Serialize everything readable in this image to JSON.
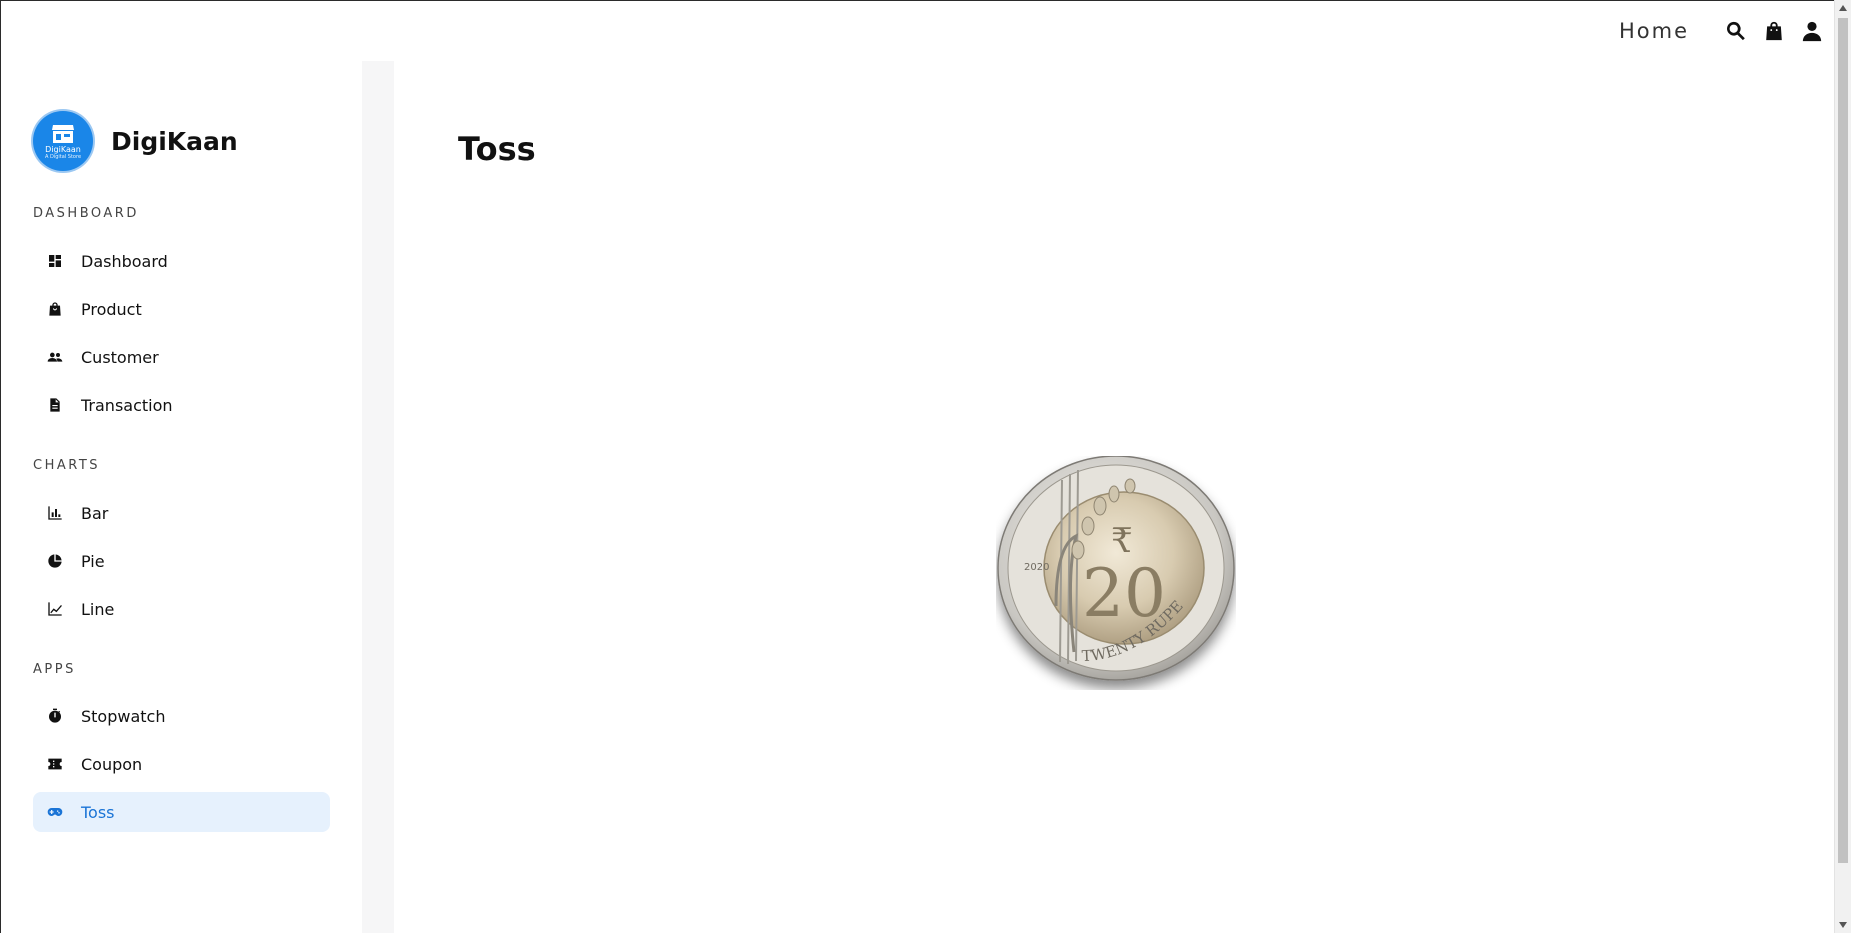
{
  "header": {
    "home_label": "Home",
    "icons": [
      "search-icon",
      "shopping-bag-icon",
      "user-icon"
    ]
  },
  "brand": {
    "name": "DigiKaan",
    "logo_line1": "DigiKaan",
    "logo_line2": "A Digital Store",
    "logo_color": "#1a86e8"
  },
  "sidebar": {
    "sections": [
      {
        "label": "DASHBOARD",
        "items": [
          {
            "label": "Dashboard",
            "icon": "dashboard-icon"
          },
          {
            "label": "Product",
            "icon": "shopping-bag-icon"
          },
          {
            "label": "Customer",
            "icon": "people-icon"
          },
          {
            "label": "Transaction",
            "icon": "document-icon"
          }
        ]
      },
      {
        "label": "CHARTS",
        "items": [
          {
            "label": "Bar",
            "icon": "bar-chart-icon"
          },
          {
            "label": "Pie",
            "icon": "pie-chart-icon"
          },
          {
            "label": "Line",
            "icon": "line-chart-icon"
          }
        ]
      },
      {
        "label": "APPS",
        "items": [
          {
            "label": "Stopwatch",
            "icon": "stopwatch-icon"
          },
          {
            "label": "Coupon",
            "icon": "coupon-icon"
          },
          {
            "label": "Toss",
            "icon": "gamepad-icon",
            "active": true
          }
        ]
      }
    ],
    "active_color": "#1a74d6",
    "active_bg": "#e6f1fd"
  },
  "main": {
    "title": "Toss"
  },
  "coin": {
    "denomination": "20",
    "legend": "TWENTY RUPEES",
    "year": "2020",
    "symbol": "₹"
  }
}
